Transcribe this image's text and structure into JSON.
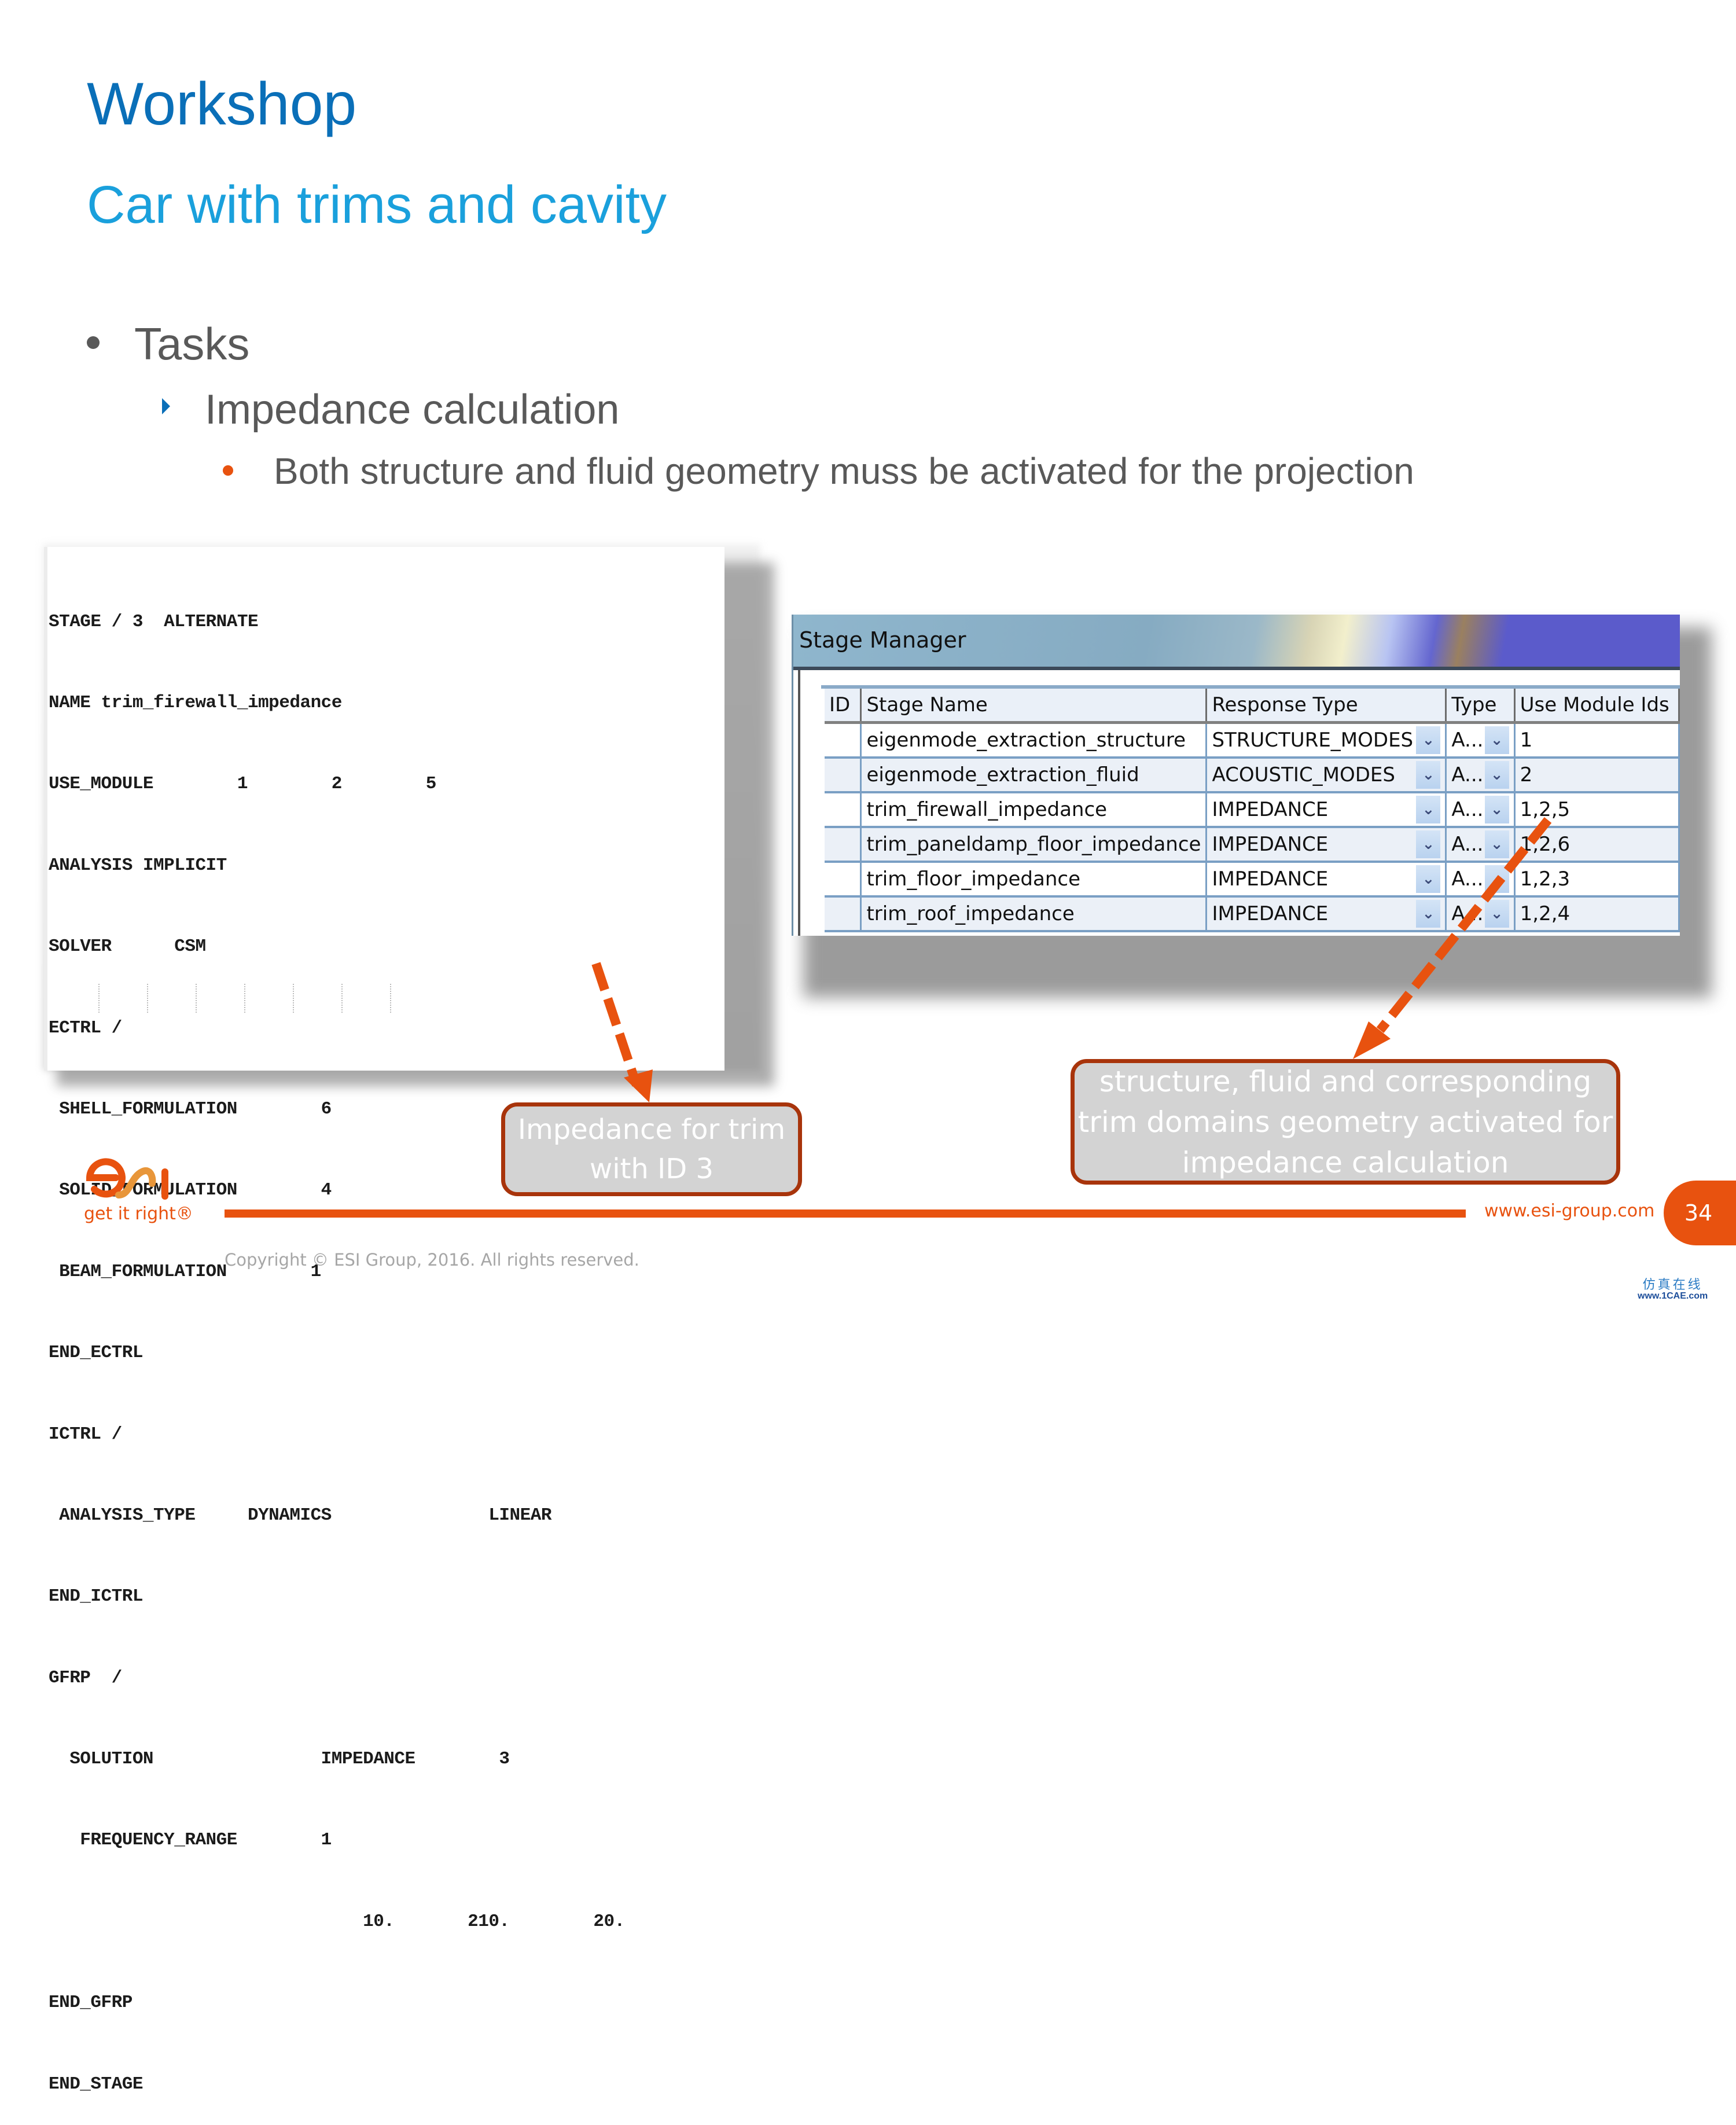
{
  "slide": {
    "title": "Workshop",
    "subtitle": "Car with trims and cavity",
    "bullets": {
      "level1": "Tasks",
      "level2": "Impedance calculation",
      "level3": "Both structure and fluid geometry muss be activated for the projection"
    },
    "colors": {
      "title": "#0a6fb8",
      "subtitle": "#1aa0dc",
      "accent": "#e8520f",
      "callout_border": "#a8340b",
      "callout_fill": "#d3d3d3"
    }
  },
  "code_panel": {
    "lines": [
      "STAGE / 3  ALTERNATE",
      "NAME trim_firewall_impedance",
      "USE_MODULE        1        2        5",
      "ANALYSIS IMPLICIT",
      "SOLVER      CSM",
      "ECTRL /",
      " SHELL_FORMULATION        6",
      " SOLID_FORMULATION        4",
      " BEAM_FORMULATION        1",
      "END_ECTRL",
      "ICTRL /",
      " ANALYSIS_TYPE     DYNAMICS               LINEAR",
      "END_ICTRL",
      "GFRP  /",
      "  SOLUTION                IMPEDANCE        3",
      "   FREQUENCY_RANGE        1",
      "                              10.       210.        20.",
      "END_GFRP",
      "END_STAGE"
    ]
  },
  "stage_manager": {
    "window_title": "Stage Manager",
    "columns": [
      "ID",
      "Stage Name",
      "Response Type",
      "Type",
      "Use Module Ids"
    ],
    "rows": [
      {
        "id": "",
        "name": "eigenmode_extraction_structure",
        "response_type": "STRUCTURE_MODES",
        "type": "A...",
        "modules": "1"
      },
      {
        "id": "",
        "name": "eigenmode_extraction_fluid",
        "response_type": "ACOUSTIC_MODES",
        "type": "A...",
        "modules": "2"
      },
      {
        "id": "",
        "name": "trim_firewall_impedance",
        "response_type": "IMPEDANCE",
        "type": "A...",
        "modules": "1,2,5"
      },
      {
        "id": "",
        "name": "trim_paneldamp_floor_impedance",
        "response_type": "IMPEDANCE",
        "type": "A...",
        "modules": "1,2,6"
      },
      {
        "id": "",
        "name": "trim_floor_impedance",
        "response_type": "IMPEDANCE",
        "type": "A...",
        "modules": "1,2,3"
      },
      {
        "id": "",
        "name": "trim_roof_impedance",
        "response_type": "IMPEDANCE",
        "type": "A...",
        "modules": "1,2,4"
      }
    ],
    "dropdown_icon": "chevron-down-icon"
  },
  "callouts": {
    "impedance_trim": "Impedance for trim with ID 3",
    "geometry_activated": "structure, fluid and corresponding trim domains geometry activated for impedance calculation"
  },
  "footer": {
    "logo_text": "esi",
    "tagline": "get it right®",
    "url": "www.esi-group.com",
    "page_number": "34",
    "copyright": "Copyright © ESI Group, 2016. All rights reserved.",
    "watermark_cn": "仿真在线",
    "watermark_url": "www.1CAE.com"
  }
}
